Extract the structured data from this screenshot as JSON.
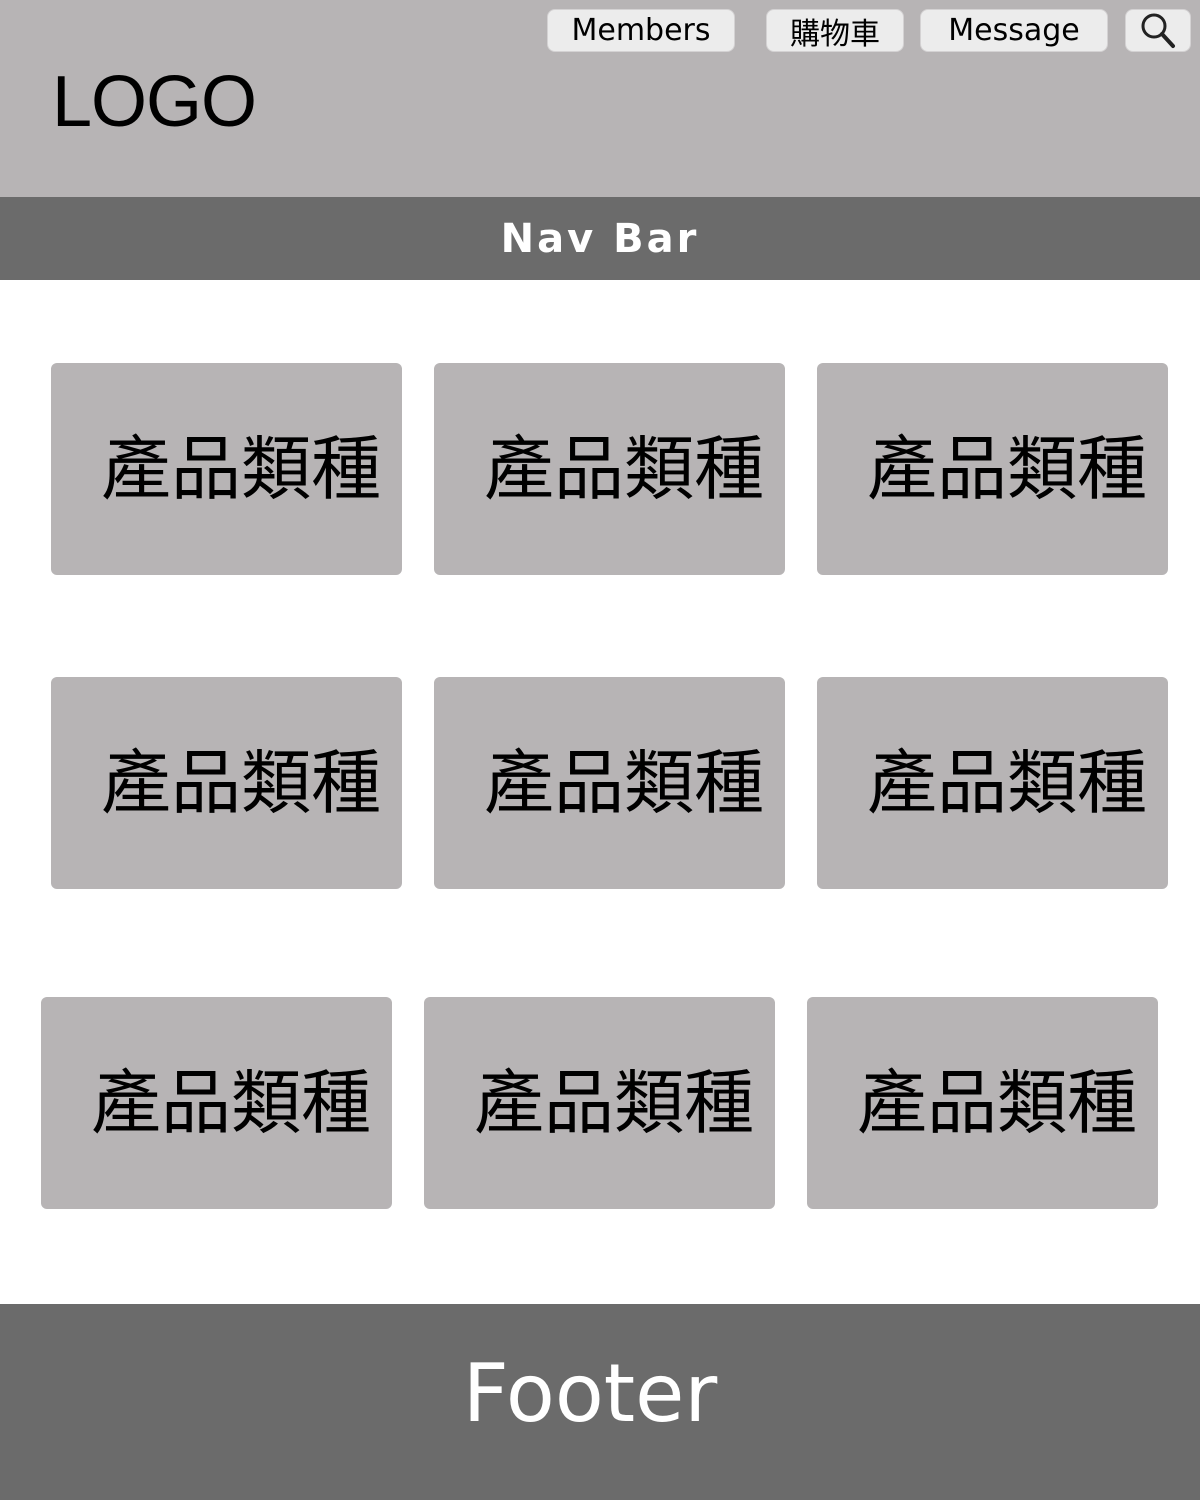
{
  "header": {
    "logo": "LOGO",
    "buttons": {
      "members": "Members",
      "cart": "購物車",
      "message": "Message"
    },
    "search_icon": "search-icon"
  },
  "navbar": {
    "label": "Nav Bar"
  },
  "categories": [
    {
      "label": "產品類種"
    },
    {
      "label": "產品類種"
    },
    {
      "label": "產品類種"
    },
    {
      "label": "產品類種"
    },
    {
      "label": "產品類種"
    },
    {
      "label": "產品類種"
    },
    {
      "label": "產品類種"
    },
    {
      "label": "產品類種"
    },
    {
      "label": "產品類種"
    }
  ],
  "footer": {
    "label": "Footer"
  },
  "colors": {
    "header_bg": "#b7b4b5",
    "bar_bg": "#6b6b6b",
    "button_bg": "#ececec",
    "card_bg": "#b7b4b5"
  }
}
